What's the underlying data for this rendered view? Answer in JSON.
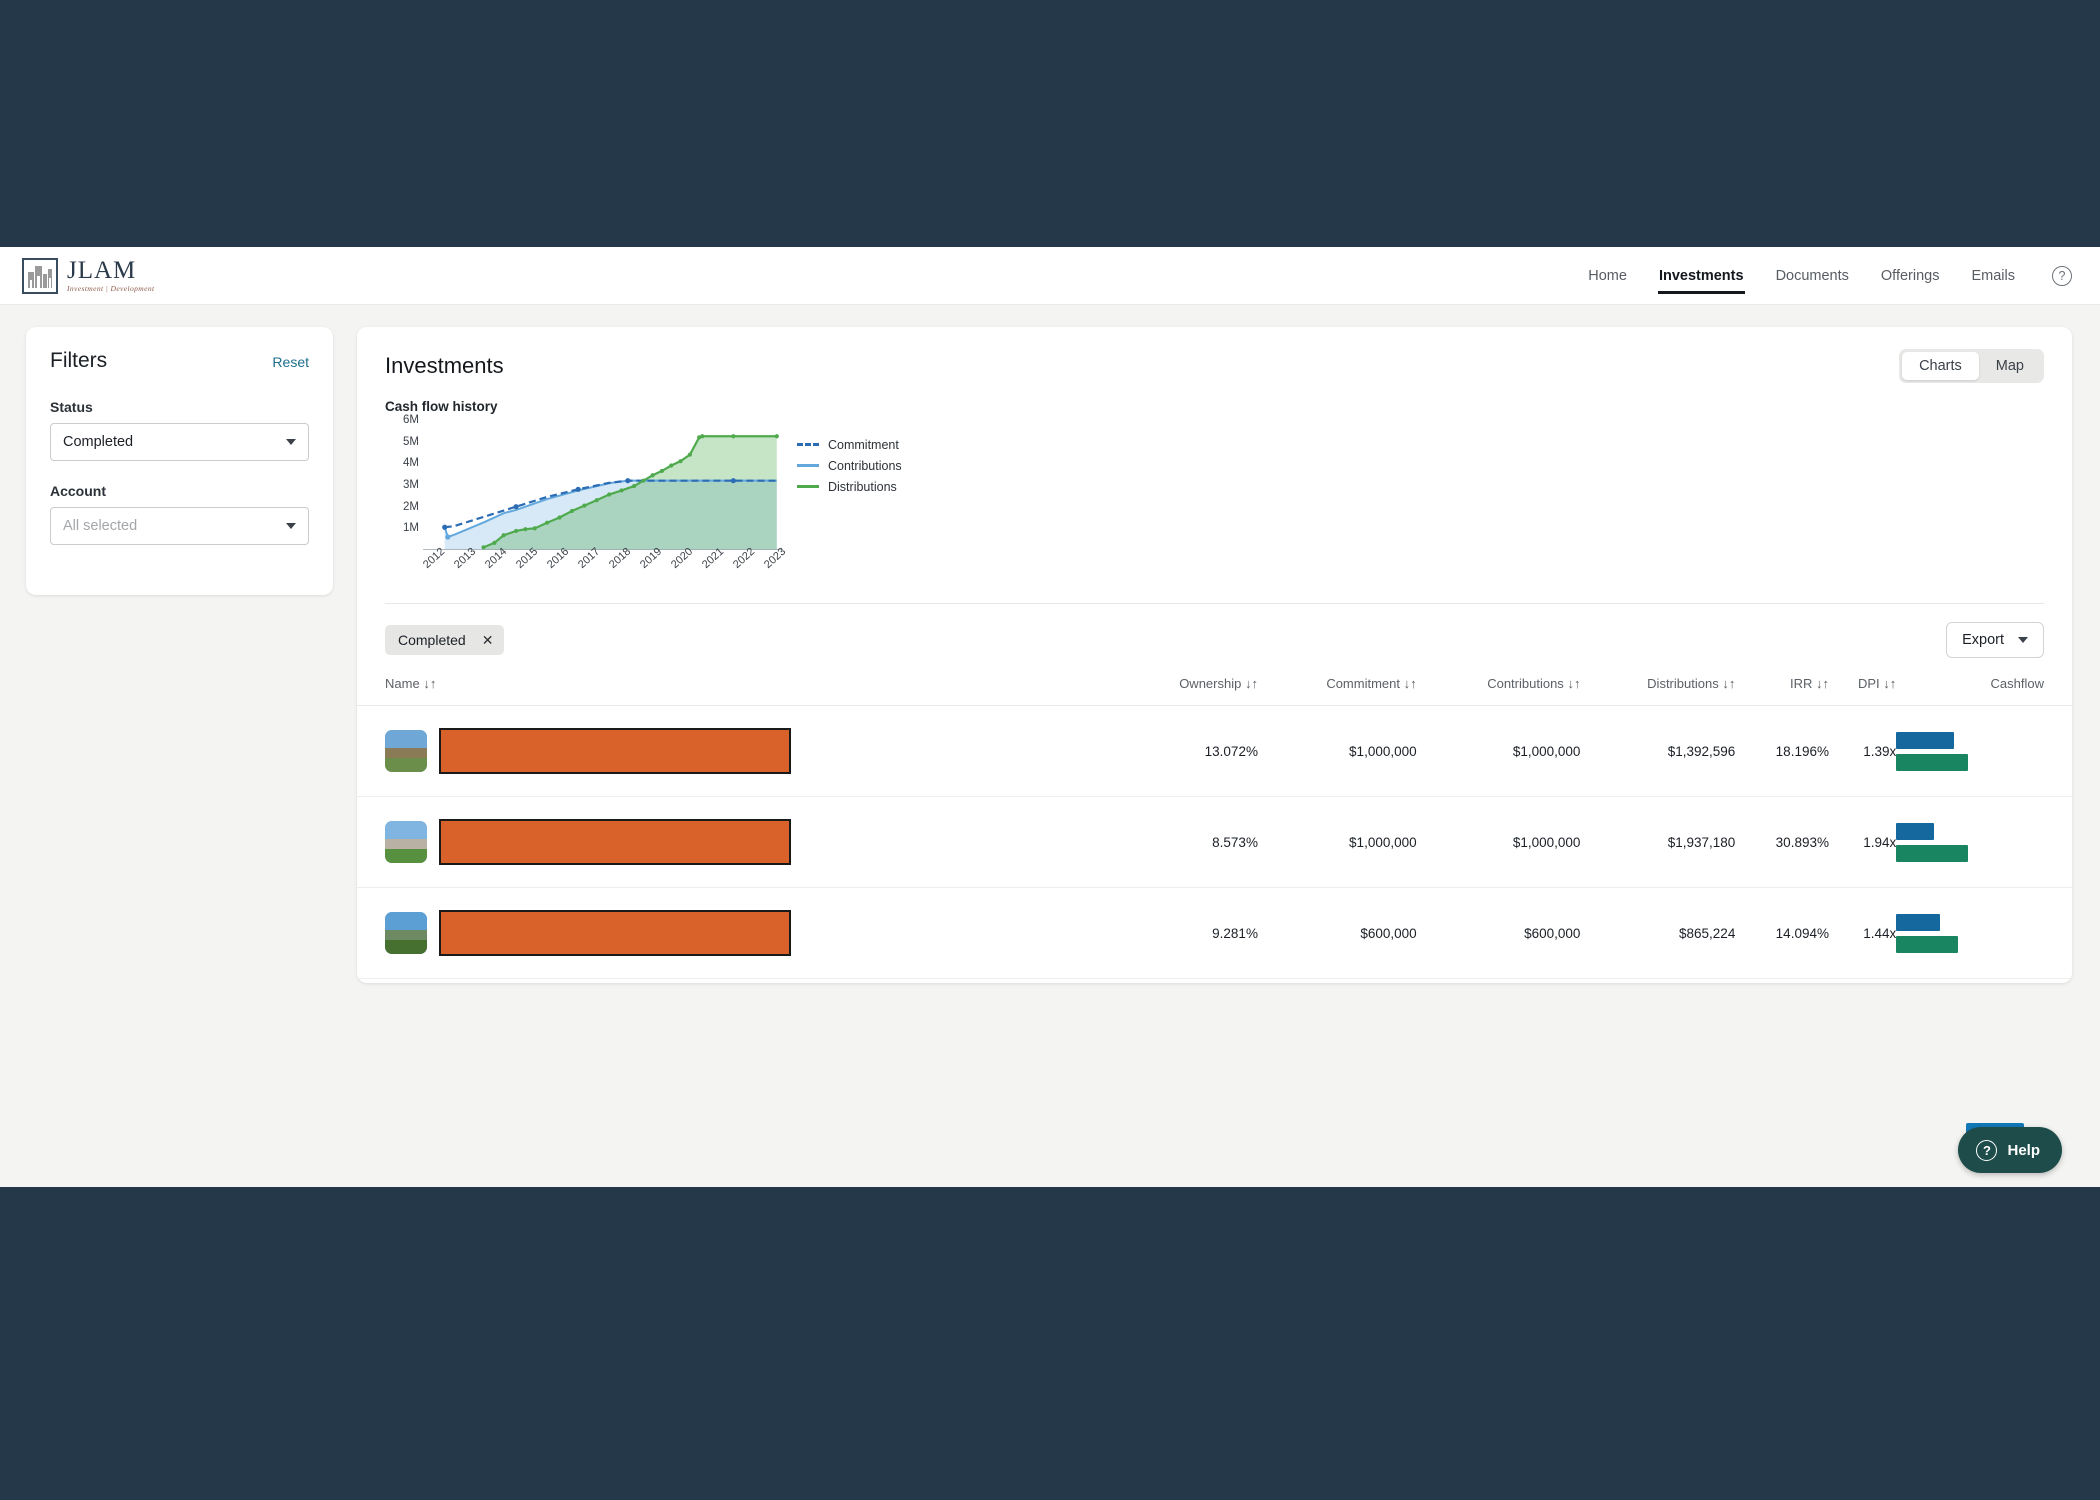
{
  "brand": {
    "name": "JLAM",
    "tagline": "Investment | Development",
    "logo_icon": "building-logo-icon"
  },
  "nav": {
    "items": [
      {
        "label": "Home",
        "active": false
      },
      {
        "label": "Investments",
        "active": true
      },
      {
        "label": "Documents",
        "active": false
      },
      {
        "label": "Offerings",
        "active": false
      },
      {
        "label": "Emails",
        "active": false
      }
    ],
    "help_icon": "question-circle-icon"
  },
  "filters": {
    "title": "Filters",
    "reset_label": "Reset",
    "status_label": "Status",
    "status_value": "Completed",
    "account_label": "Account",
    "account_placeholder": "All selected"
  },
  "main": {
    "title": "Investments",
    "view_toggle": [
      {
        "label": "Charts",
        "active": true
      },
      {
        "label": "Map",
        "active": false
      }
    ],
    "active_chip": "Completed",
    "chip_remove_icon": "close-icon",
    "export_label": "Export",
    "export_caret_icon": "chevron-down-icon"
  },
  "table": {
    "sort_icon": "sort-updown-icon",
    "columns": [
      "Name",
      "Ownership",
      "Commitment",
      "Contributions",
      "Distributions",
      "IRR",
      "DPI",
      "Cashflow"
    ],
    "rows": [
      {
        "name": "",
        "ownership": "13.072%",
        "commitment": "$1,000,000",
        "contributions": "$1,000,000",
        "distributions": "$1,392,596",
        "irr": "18.196%",
        "dpi": "1.39x",
        "cashflow": {
          "contributions_width": 58,
          "distributions_width": 72
        }
      },
      {
        "name": "",
        "ownership": "8.573%",
        "commitment": "$1,000,000",
        "contributions": "$1,000,000",
        "distributions": "$1,937,180",
        "irr": "30.893%",
        "dpi": "1.94x",
        "cashflow": {
          "contributions_width": 38,
          "distributions_width": 72
        }
      },
      {
        "name": "",
        "ownership": "9.281%",
        "commitment": "$600,000",
        "contributions": "$600,000",
        "distributions": "$865,224",
        "irr": "14.094%",
        "dpi": "1.44x",
        "cashflow": {
          "contributions_width": 44,
          "distributions_width": 62
        }
      }
    ]
  },
  "help_widget": {
    "label": "Help",
    "icon": "question-circle-icon"
  },
  "colors": {
    "commitment": "#2b6cb5",
    "contributions": "#63a8dd",
    "distributions": "#4faa4e",
    "cashflow_blue": "#15689e",
    "cashflow_green": "#1a8561",
    "accent_link": "#1d6f8b",
    "page_backdrop": "#25384a",
    "redaction": "#d9622b"
  },
  "chart_data": {
    "type": "area",
    "title": "Cash flow history",
    "xlabel": "",
    "ylabel": "",
    "grid": false,
    "legend_position": "right",
    "ylim": [
      0,
      6000000
    ],
    "ytick_labels": [
      "1M",
      "2M",
      "3M",
      "4M",
      "5M",
      "6M"
    ],
    "ytick_values": [
      1000000,
      2000000,
      3000000,
      4000000,
      5000000,
      6000000
    ],
    "xtick_labels": [
      "2012",
      "2013",
      "2014",
      "2015",
      "2016",
      "2017",
      "2018",
      "2019",
      "2020",
      "2021",
      "2022",
      "2023"
    ],
    "xlim": [
      2012,
      2023.6
    ],
    "series": [
      {
        "name": "Commitment",
        "style": "dashed-line",
        "color": "#2b6cb5",
        "x": [
          2012.7,
          2013.0,
          2014.0,
          2015.0,
          2016.0,
          2017.0,
          2018.0,
          2018.6,
          2019.0,
          2020.0,
          2021.0,
          2022.0,
          2023.4
        ],
        "values": [
          1050000,
          1100000,
          1550000,
          2000000,
          2450000,
          2800000,
          3100000,
          3200000,
          3200000,
          3200000,
          3200000,
          3200000,
          3200000
        ]
      },
      {
        "name": "Contributions",
        "style": "area-line",
        "color": "#63a8dd",
        "x": [
          2012.7,
          2012.8,
          2013.0,
          2014.0,
          2014.6,
          2015.0,
          2015.7,
          2016.0,
          2017.0,
          2018.0,
          2018.6,
          2019.0,
          2020.0,
          2021.0,
          2022.0,
          2023.4
        ],
        "values": [
          1050000,
          600000,
          700000,
          1300000,
          1700000,
          1850000,
          2200000,
          2350000,
          2750000,
          3080000,
          3200000,
          3200000,
          3200000,
          3200000,
          3200000,
          3200000
        ]
      },
      {
        "name": "Distributions",
        "style": "area-line",
        "color": "#4faa4e",
        "x": [
          2013.95,
          2014.3,
          2014.6,
          2015.0,
          2015.3,
          2015.6,
          2016.0,
          2016.4,
          2016.8,
          2017.2,
          2017.6,
          2018.0,
          2018.4,
          2018.8,
          2019.1,
          2019.4,
          2019.7,
          2020.0,
          2020.3,
          2020.6,
          2020.9,
          2021.0,
          2022.0,
          2023.4
        ],
        "values": [
          120000,
          330000,
          680000,
          880000,
          960000,
          1000000,
          1260000,
          1500000,
          1800000,
          2050000,
          2300000,
          2560000,
          2750000,
          2950000,
          3200000,
          3450000,
          3650000,
          3900000,
          4100000,
          4400000,
          5200000,
          5250000,
          5250000,
          5250000
        ]
      }
    ]
  }
}
